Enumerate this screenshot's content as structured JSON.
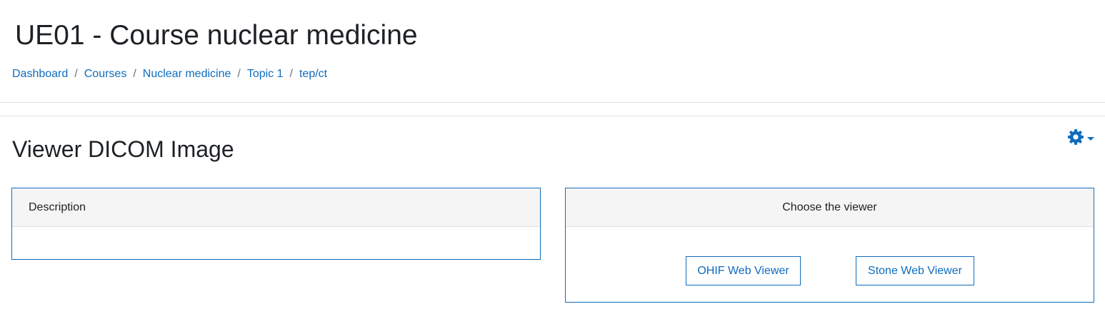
{
  "page": {
    "title": "UE01 - Course nuclear medicine"
  },
  "breadcrumb": {
    "items": [
      "Dashboard",
      "Courses",
      "Nuclear medicine",
      "Topic 1",
      "tep/ct"
    ],
    "separator": "/"
  },
  "activity": {
    "title": "Viewer DICOM Image",
    "settings_icon": "gear-icon",
    "settings_caret_icon": "caret-down-icon"
  },
  "description_panel": {
    "header": "Description",
    "body": ""
  },
  "viewer_panel": {
    "header": "Choose the viewer",
    "buttons": {
      "ohif": "OHIF Web Viewer",
      "stone": "Stone Web Viewer"
    }
  },
  "colors": {
    "accent": "#0f6cbf",
    "text": "#1d2125",
    "panel_header_bg": "#f5f5f5",
    "divider": "#dee2e6"
  }
}
